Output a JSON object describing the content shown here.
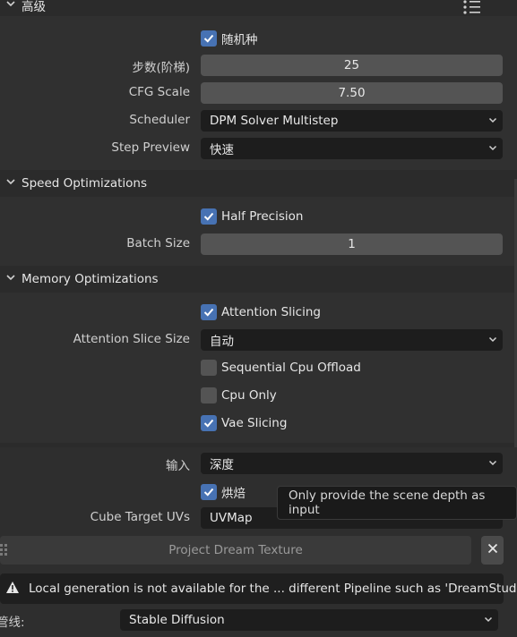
{
  "advanced": {
    "title": "高级",
    "seed_label": "随机种",
    "seed_checked": true,
    "steps_label": "步数(阶梯)",
    "steps_value": "25",
    "cfg_label": "CFG Scale",
    "cfg_value": "7.50",
    "scheduler_label": "Scheduler",
    "scheduler_value": "DPM Solver Multistep",
    "step_preview_label": "Step Preview",
    "step_preview_value": "快速"
  },
  "speed": {
    "title": "Speed Optimizations",
    "half_precision_label": "Half Precision",
    "half_precision_checked": true,
    "batch_size_label": "Batch Size",
    "batch_size_value": "1"
  },
  "memory": {
    "title": "Memory Optimizations",
    "attention_slicing_label": "Attention Slicing",
    "attention_slicing_checked": true,
    "attention_slice_size_label": "Attention Slice Size",
    "attention_slice_size_value": "自动",
    "sequential_offload_label": "Sequential Cpu Offload",
    "sequential_offload_checked": false,
    "cpu_only_label": "Cpu Only",
    "cpu_only_checked": false,
    "vae_slicing_label": "Vae Slicing",
    "vae_slicing_checked": true
  },
  "project": {
    "input_label": "输入",
    "input_value": "深度",
    "bake_label": "烘焙",
    "bake_checked": true,
    "cube_target_label": "Cube Target UVs",
    "cube_target_value": "UVMap",
    "tooltip_text": "Only provide the scene depth as input",
    "project_button_label": "Project Dream Texture",
    "warning_text": "Local generation is not available for the ... different Pipeline such as 'DreamStudio'",
    "pipeline_label": "管线:",
    "pipeline_value": "Stable Diffusion"
  },
  "colors": {
    "panel_bg": "#303030",
    "field_bg": "#545454",
    "dropdown_bg": "#1d1d1d",
    "checkbox_on": "#4772b3"
  }
}
